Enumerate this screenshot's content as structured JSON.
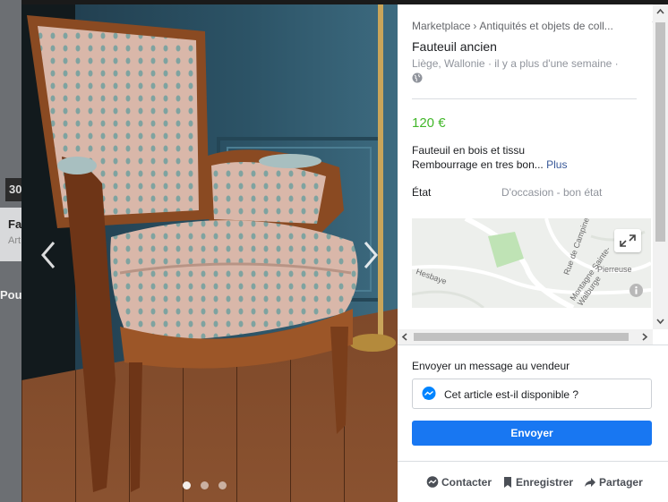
{
  "background": {
    "badge_text": "30",
    "card_title": "Fau",
    "card_sub": "Art",
    "left_text": "Pour"
  },
  "viewer": {
    "photo_count": 3,
    "active_photo_index": 0,
    "prev_icon": "chevron-left-icon",
    "next_icon": "chevron-right-icon"
  },
  "listing": {
    "breadcrumb": [
      "Marketplace",
      "Antiquités et objets de coll..."
    ],
    "title": "Fauteuil ancien",
    "meta": "Liège, Wallonie · il y a plus d'une semaine ·",
    "price": "120 €",
    "description_line1": "Fauteuil en bois et tissu",
    "description_line2": "Rembourrage en tres bon...",
    "more_label": "Plus",
    "condition_label": "État",
    "condition_value": "D'occasion - bon état",
    "map_labels": [
      "Rue de Campine",
      "Montagne Sainte-Walburge",
      "Pierreuse",
      "Hesbaye"
    ]
  },
  "message": {
    "heading": "Envoyer un message au vendeur",
    "input_value": "Cet article est-il disponible ?",
    "send_label": "Envoyer"
  },
  "actions": [
    {
      "label": "Contacter",
      "icon": "messenger-icon"
    },
    {
      "label": "Enregistrer",
      "icon": "bookmark-icon"
    },
    {
      "label": "Partager",
      "icon": "share-icon"
    }
  ],
  "colors": {
    "price": "#42b72a",
    "accent": "#1877f2",
    "link": "#385898"
  }
}
